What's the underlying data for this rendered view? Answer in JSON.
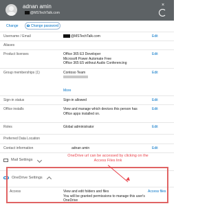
{
  "header": {
    "user_name": "adnan amin",
    "user_email": "@MSTechTalk.com",
    "close_glyph": "×"
  },
  "toolbar": {
    "change_label": "Change",
    "change_password_label": "Change password"
  },
  "fields": [
    {
      "label": "Username / Email",
      "value": "@MSTechTalk.com",
      "edit": "Edit"
    },
    {
      "label": "Aliases",
      "value": "",
      "edit": ""
    },
    {
      "label": "Product licenses",
      "lines": [
        "Office 365 E3 Developer",
        "Microsoft Power Automate Free",
        "Office 365 E5 without Audio Conferencing"
      ],
      "edit": "Edit"
    },
    {
      "label": "Group memberships (1)",
      "lines": [
        "Contoso Team"
      ],
      "more": "More",
      "edit": "Edit"
    },
    {
      "label": "Sign-in status",
      "value": "Sign-in allowed",
      "edit": "Edit"
    },
    {
      "label": "Office installs",
      "lines": [
        "View and manage which devices this person has",
        "Office apps installed on."
      ],
      "edit": "Edit"
    },
    {
      "label": "Roles",
      "value": "Global administrator",
      "edit": "Edit"
    },
    {
      "label": "Preferred Data Location",
      "value": "",
      "edit": ""
    },
    {
      "label": "Contact information",
      "value": "adnan amin",
      "edit": "Edit"
    }
  ],
  "sections": {
    "mail_settings": "Mail Settings",
    "onedrive_settings": "OneDrive Settings"
  },
  "access": {
    "label": "Access",
    "lines": [
      "View and edit folders and files",
      "You will be granted permissions to manage this user's",
      "OneDrive"
    ],
    "edit": "Access files"
  },
  "callout": {
    "text": "OneDrive url can be accessed by clicking on the Access Files link"
  },
  "colors": {
    "header_bg": "#5d6265",
    "link": "#0072c6",
    "callout": "#e8424a"
  }
}
